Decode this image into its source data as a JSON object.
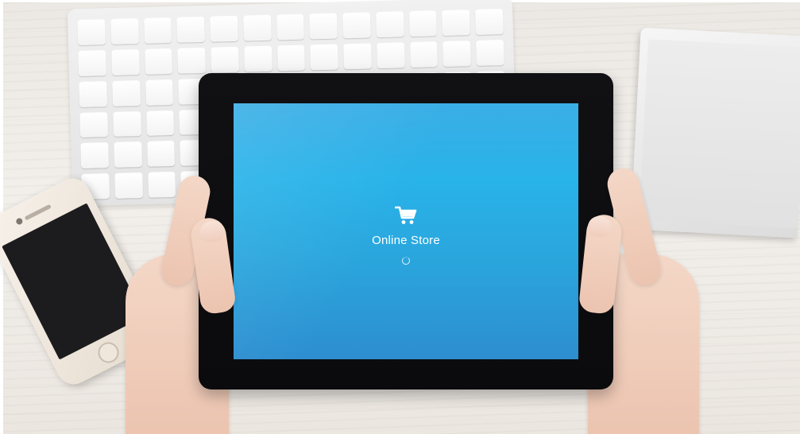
{
  "tablet_app": {
    "title": "Online Store",
    "icon": "shopping-cart-icon",
    "status": "loading"
  },
  "colors": {
    "screen_top": "#3aaee6",
    "screen_mid": "#28b3e9",
    "screen_bottom": "#2d8ed0",
    "tablet_bezel": "#111114",
    "desk": "#ece8e3",
    "text": "#ffffff"
  }
}
